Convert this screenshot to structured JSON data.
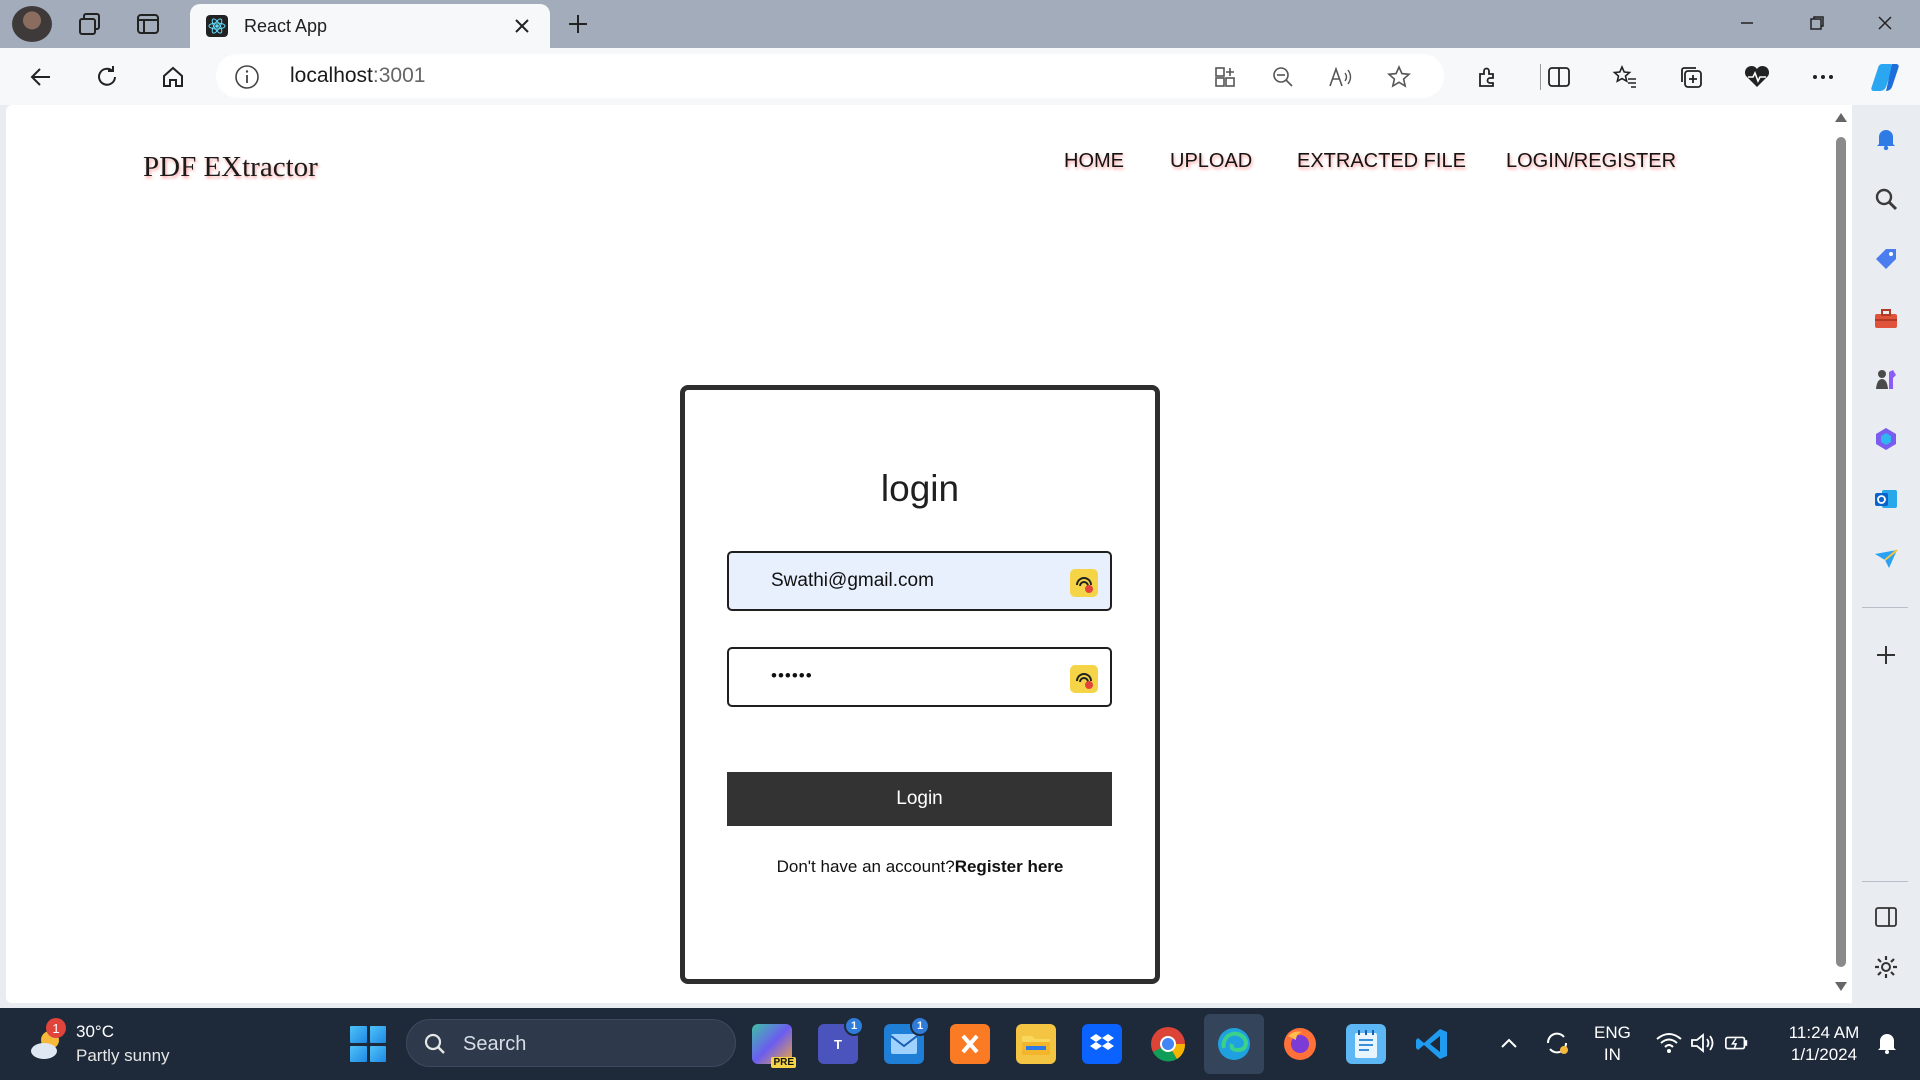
{
  "browser": {
    "tab_title": "React App",
    "address_host": "localhost",
    "address_port": ":3001"
  },
  "page": {
    "brand": "PDF EXtractor",
    "nav": [
      "HOME",
      "UPLOAD",
      "EXTRACTED FILE",
      "LOGIN/REGISTER"
    ]
  },
  "login": {
    "title": "login",
    "email_value": "Swathi@gmail.com",
    "password_masked": "••••••",
    "button_label": "Login",
    "register_prompt": "Don't have an account?",
    "register_link": "Register here"
  },
  "taskbar": {
    "weather_temp": "30°C",
    "weather_desc": "Partly sunny",
    "weather_badge": "1",
    "search_placeholder": "Search",
    "teams_badge": "1",
    "mail_badge": "1",
    "language": "ENG",
    "region": "IN",
    "time": "11:24 AM",
    "date": "1/1/2024"
  },
  "colors": {
    "card_border": "#2e2e2e",
    "button_bg": "#333333",
    "email_fill": "#e8f0fe",
    "nav_shadow": "#ff9a9a"
  }
}
